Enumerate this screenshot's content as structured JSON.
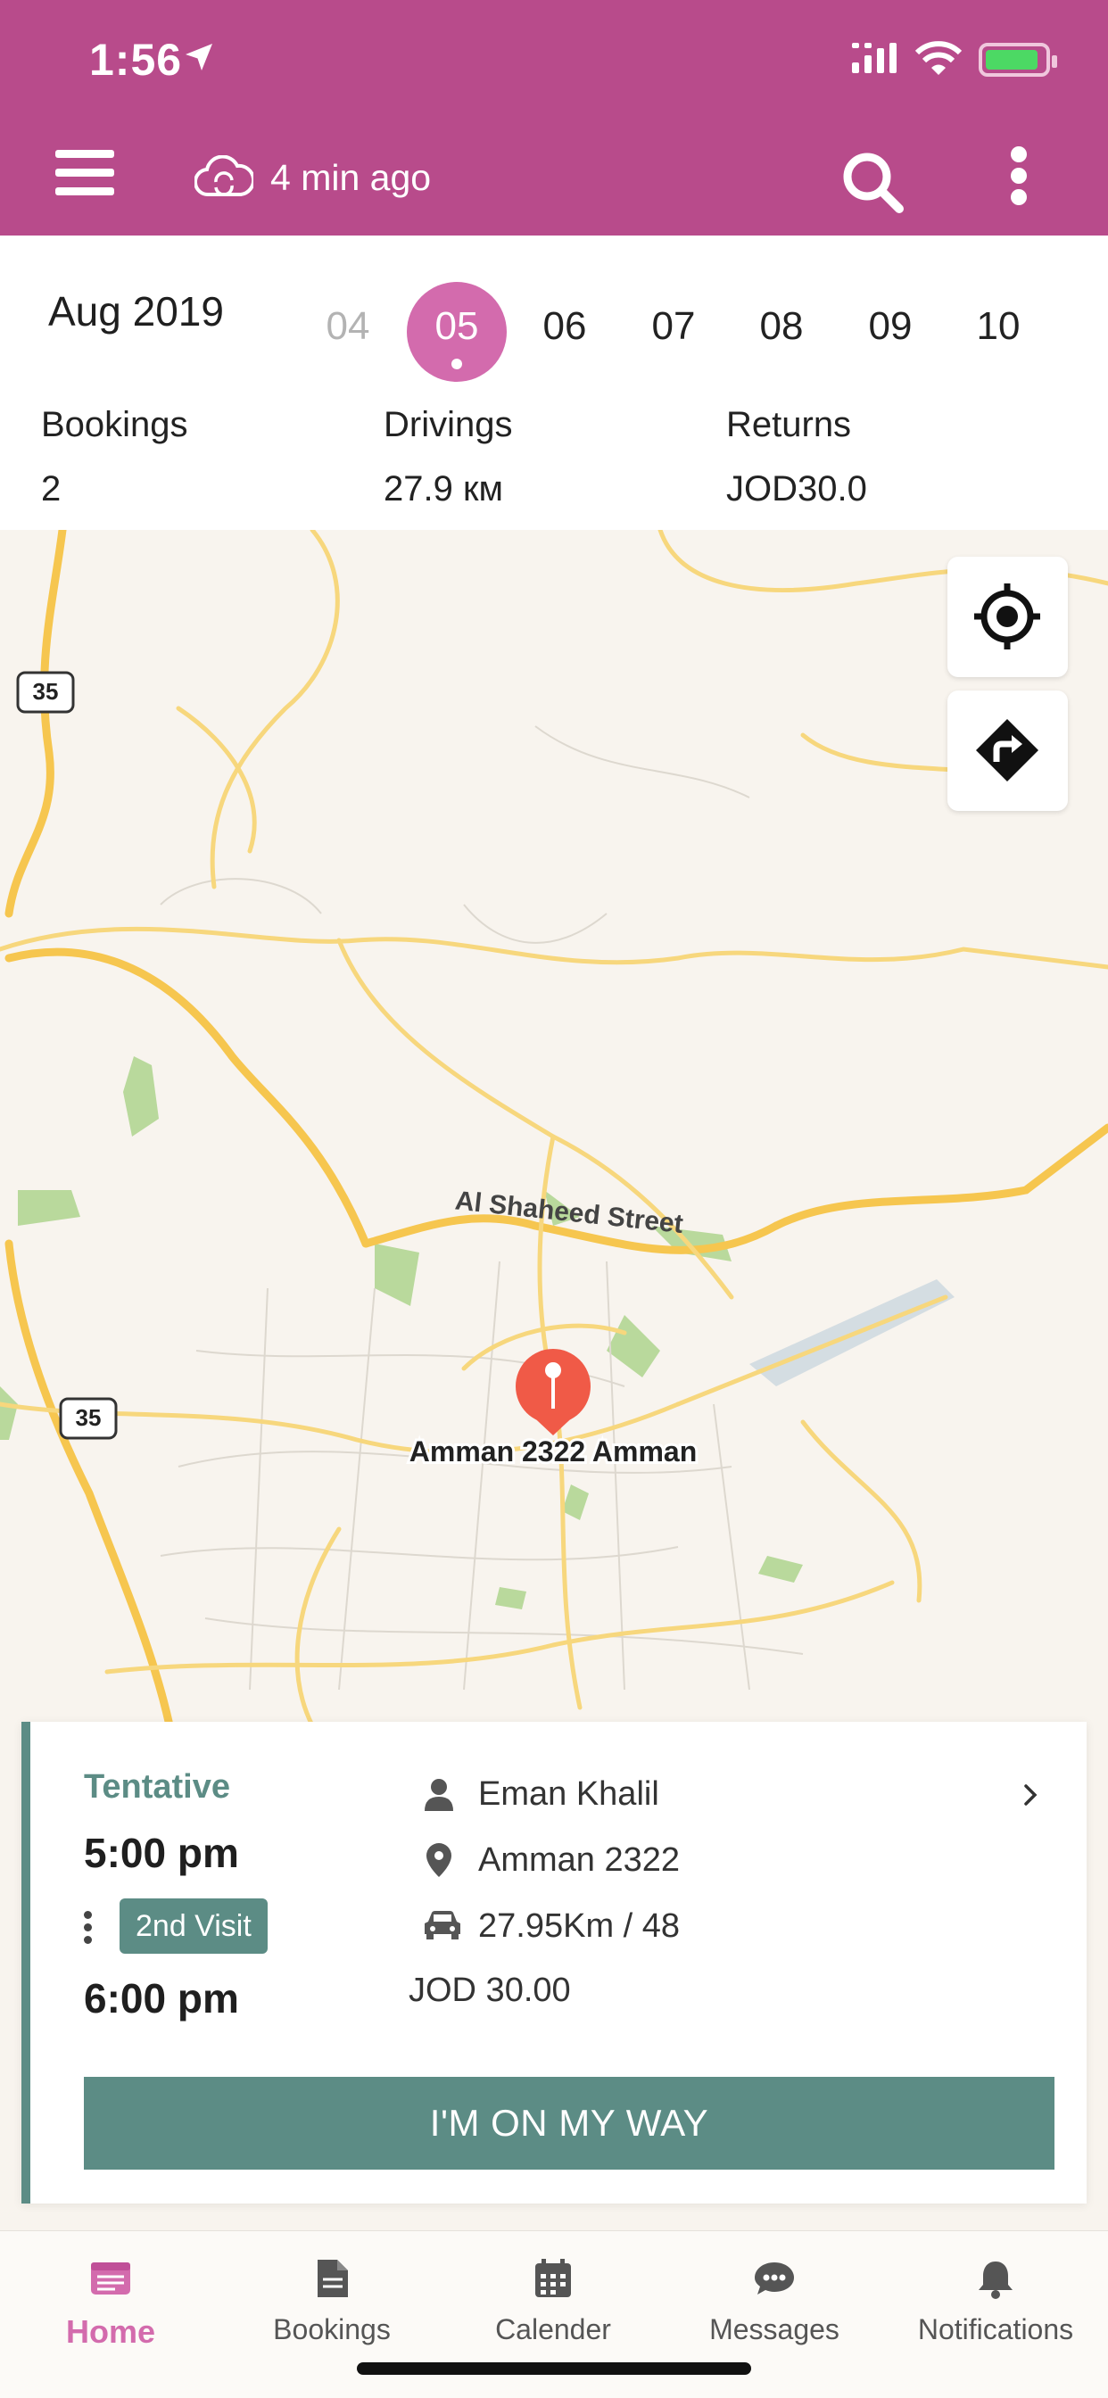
{
  "status_bar": {
    "time": "1:56"
  },
  "app_bar": {
    "sync_label": "4 min ago"
  },
  "date_strip": {
    "month": "Aug 2019",
    "days": [
      "04",
      "05",
      "06",
      "07",
      "08",
      "09",
      "10"
    ],
    "selected_day": "05"
  },
  "stats": [
    {
      "label": "Bookings",
      "value": "2"
    },
    {
      "label": "Drivings",
      "value": "27.9 км"
    },
    {
      "label": "Returns",
      "value": "JOD30.0"
    }
  ],
  "map": {
    "street_label": "Al Shaheed Street",
    "route_shield_1": "35",
    "route_shield_2": "35",
    "pin_label": "Amman 2322 Amman"
  },
  "booking": {
    "status": "Tentative",
    "start_time": "5:00 pm",
    "end_time": "6:00 pm",
    "visit_badge": "2nd Visit",
    "customer": "Eman Khalil",
    "location": "Amman  2322",
    "distance": "27.95Km / 48",
    "price": "JOD 30.00",
    "cta_label": "I'M ON MY WAY"
  },
  "tabs": [
    {
      "label": "Home",
      "icon": "home-icon"
    },
    {
      "label": "Bookings",
      "icon": "document-icon"
    },
    {
      "label": "Calender",
      "icon": "calendar-icon"
    },
    {
      "label": "Messages",
      "icon": "chat-icon"
    },
    {
      "label": "Notifications",
      "icon": "bell-icon"
    }
  ],
  "colors": {
    "brand": "#b84b8b",
    "selected_day": "#d36bad",
    "accent_teal": "#5c8c85",
    "map_pin": "#f05a47"
  }
}
